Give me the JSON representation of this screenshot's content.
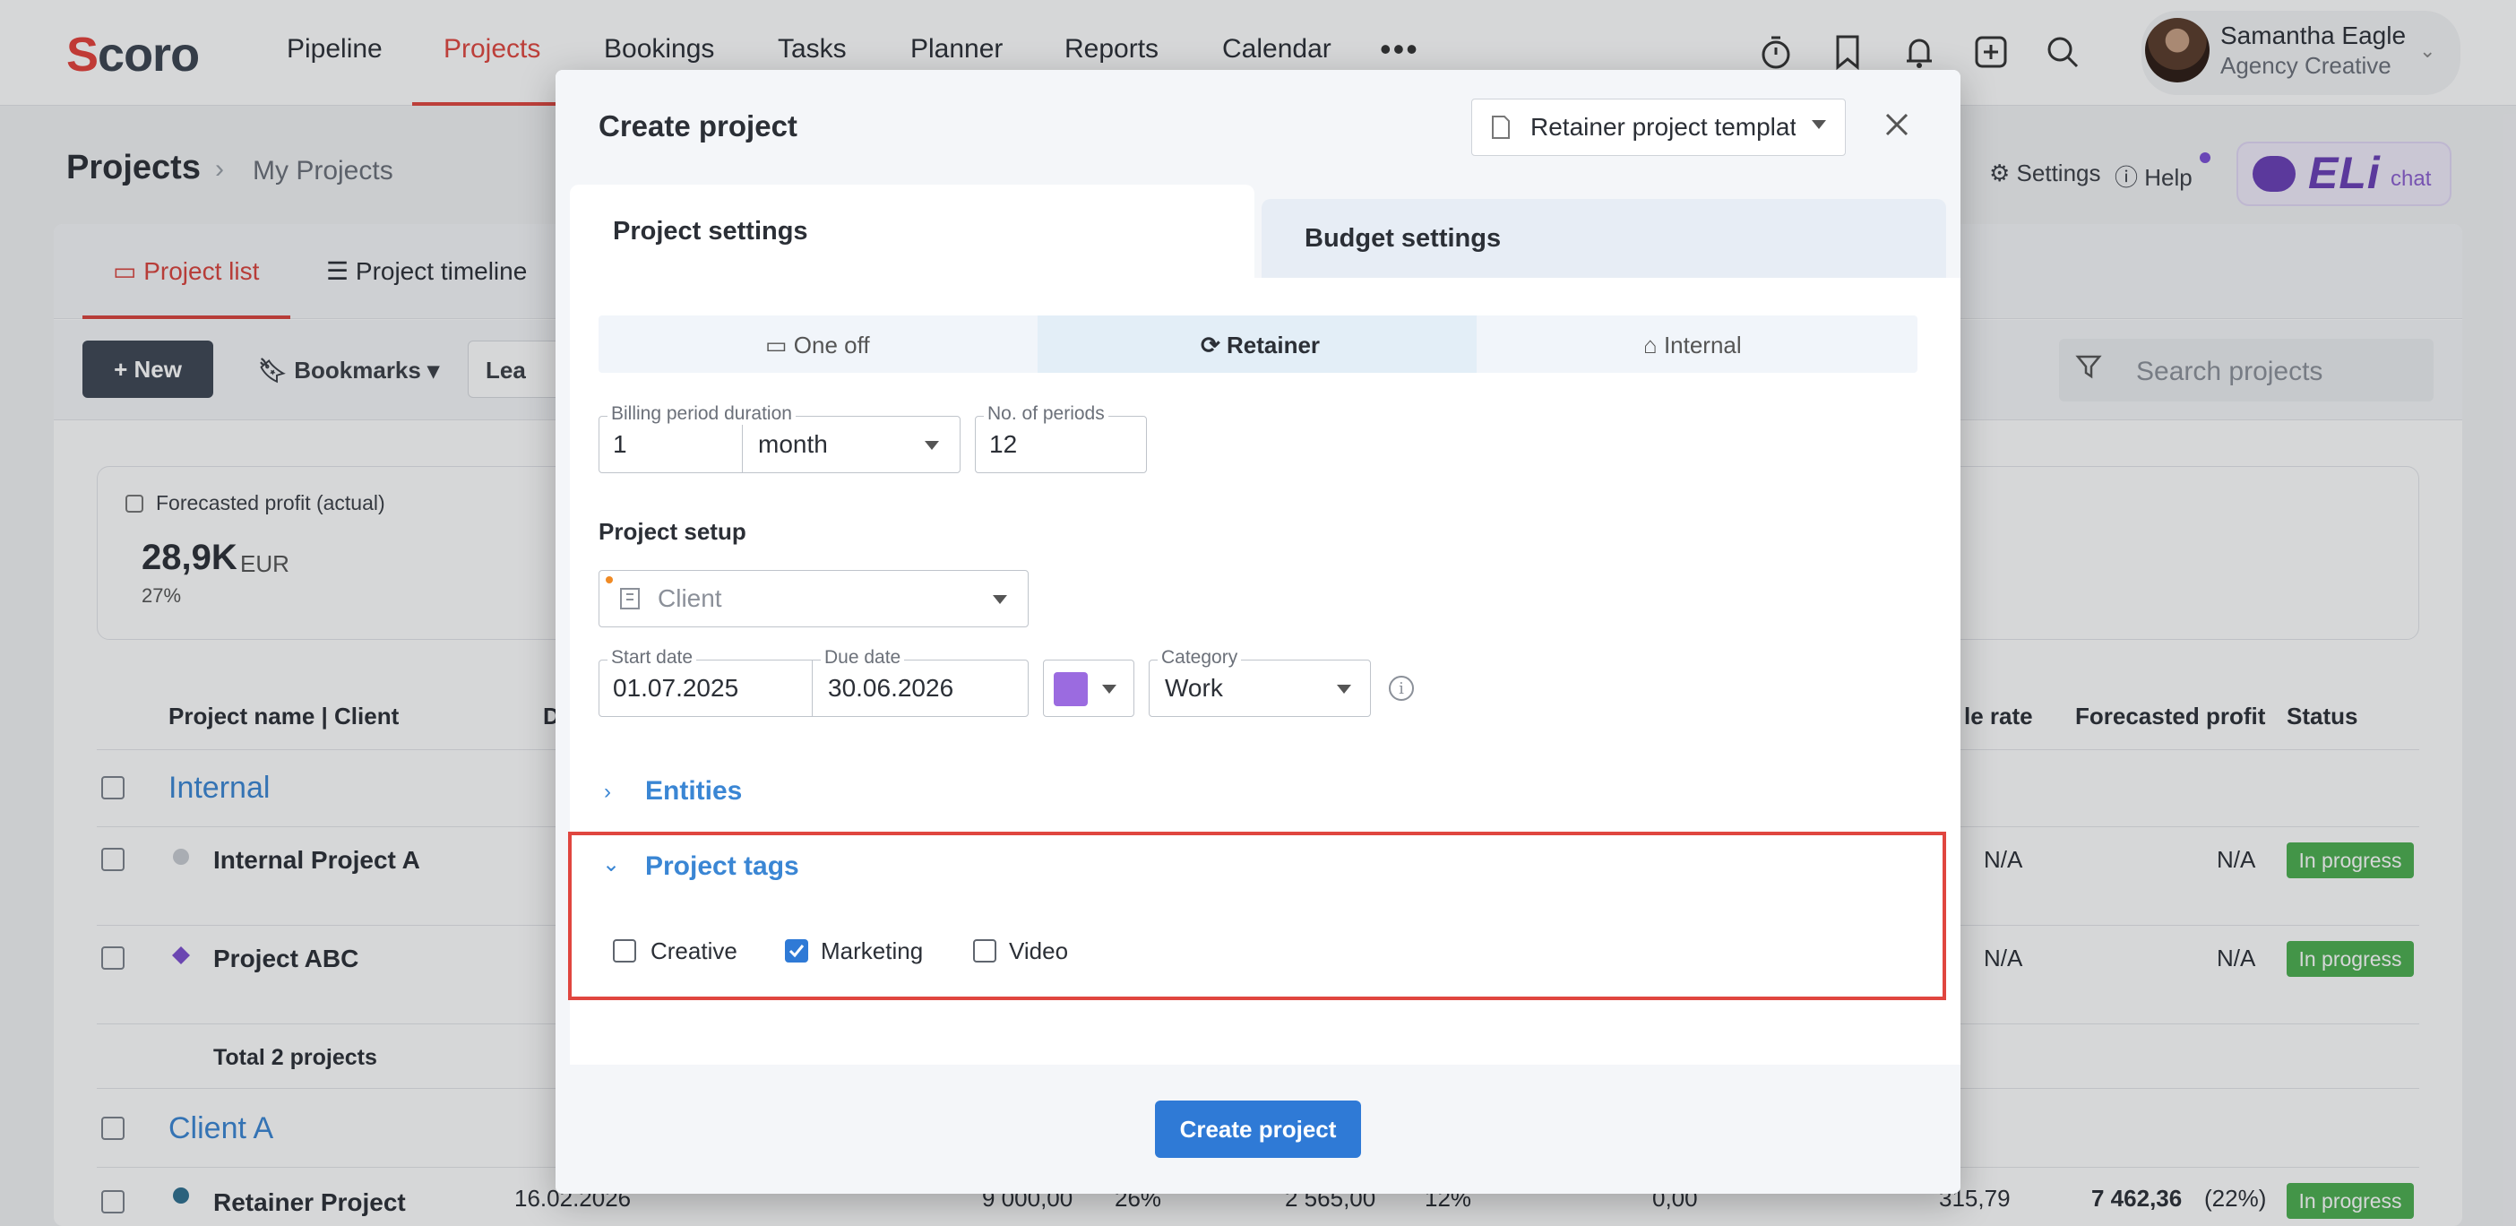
{
  "topnav": {
    "logo": "Scoro",
    "items": [
      "Pipeline",
      "Projects",
      "Bookings",
      "Tasks",
      "Planner",
      "Reports",
      "Calendar"
    ],
    "active": "Projects",
    "more": "•••",
    "icons": [
      "timer-icon",
      "bookmark-icon",
      "bell-icon",
      "add-icon",
      "search-icon"
    ],
    "user": {
      "name": "Samantha Eagle",
      "role": "Agency Creative"
    }
  },
  "subheader": {
    "title": "Projects",
    "sep": "›",
    "sub": "My Projects",
    "settings": "Settings",
    "help": "Help",
    "eli": "ELi",
    "eli_chat": "chat"
  },
  "page_tabs": [
    "Project list",
    "Project timeline"
  ],
  "toolbar": {
    "new": "+ New",
    "bookmarks": "Bookmarks",
    "lead_partial": "Lea",
    "search_placeholder": "Search projects"
  },
  "kpi": {
    "label": "Forecasted profit (actual)",
    "value": "28,9K",
    "unit": "EUR",
    "pct": "27%"
  },
  "table": {
    "headers": {
      "name": "Project name | Client",
      "d": "D",
      "rate": "le rate",
      "profit": "Forecasted profit",
      "status": "Status"
    },
    "groups": [
      {
        "label": "Internal",
        "rows": [
          {
            "name": "Internal Project A",
            "rate": "N/A",
            "profit": "N/A",
            "status": "In progress"
          },
          {
            "name": "Project ABC",
            "rate": "N/A",
            "profit": "N/A",
            "status": "In progress"
          }
        ],
        "total": "Total 2 projects"
      },
      {
        "label": "Client A",
        "rows": [
          {
            "name": "Retainer Project",
            "date": "16.02.2026",
            "v1": "9 000,00",
            "p1": "26%",
            "v2": "2 565,00",
            "p2": "12%",
            "v3": "0,00",
            "rate": "315,79",
            "profit": "7 462,36",
            "profit_pct": "(22%)",
            "status": "In progress"
          }
        ]
      }
    ]
  },
  "modal": {
    "title": "Create project",
    "template": "Retainer project templat",
    "tabs": [
      "Project settings",
      "Budget settings"
    ],
    "types": [
      "One off",
      "Retainer",
      "Internal"
    ],
    "active_type": "Retainer",
    "billing": {
      "label": "Billing period duration",
      "value": "1",
      "unit": "month"
    },
    "periods": {
      "label": "No. of periods",
      "value": "12"
    },
    "setup_heading": "Project setup",
    "client_placeholder": "Client",
    "start": {
      "label": "Start date",
      "value": "01.07.2025"
    },
    "due": {
      "label": "Due date",
      "value": "30.06.2026"
    },
    "color": "#9b6be0",
    "category": {
      "label": "Category",
      "value": "Work"
    },
    "info": "i",
    "entities": "Entities",
    "tags_heading": "Project tags",
    "tags": [
      {
        "label": "Creative",
        "checked": false
      },
      {
        "label": "Marketing",
        "checked": true
      },
      {
        "label": "Video",
        "checked": false
      }
    ],
    "create_button": "Create project"
  }
}
